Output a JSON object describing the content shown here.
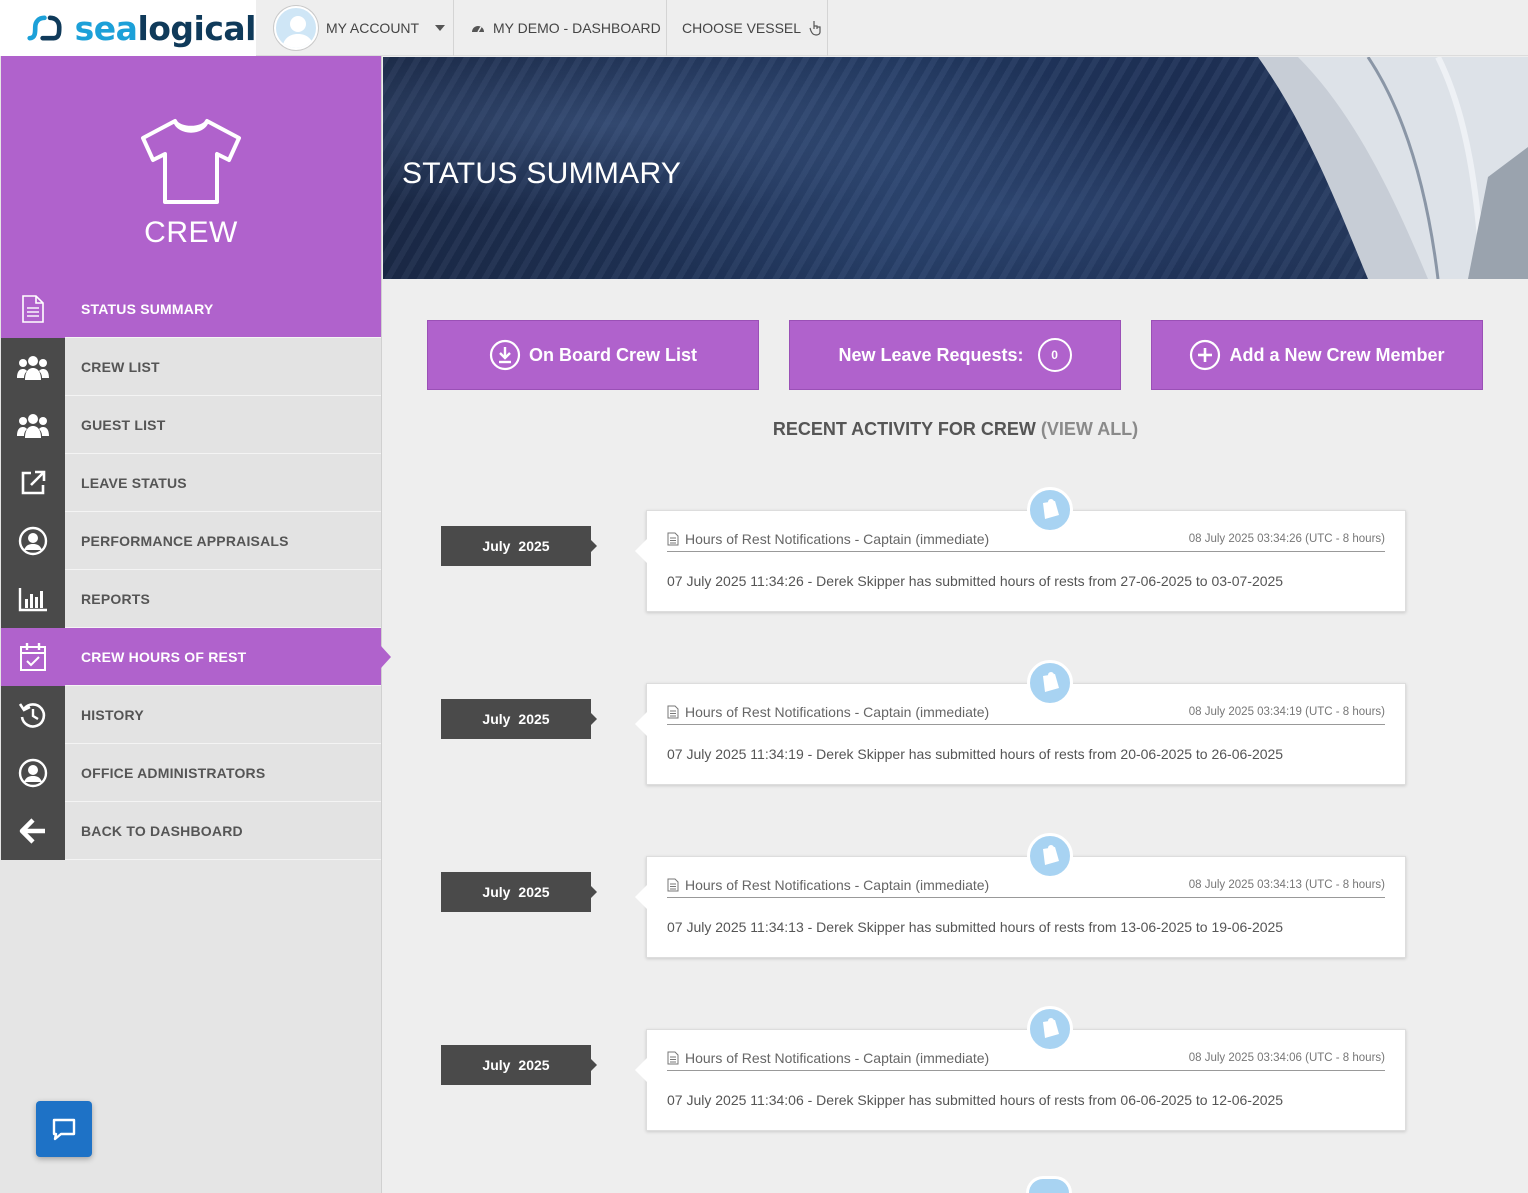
{
  "brand": {
    "part1": "sea",
    "part2": "logical"
  },
  "topnav": {
    "account": "MY ACCOUNT",
    "dashboard": "MY DEMO - DASHBOARD",
    "vessel": "CHOOSE VESSEL"
  },
  "section": {
    "title": "CREW"
  },
  "menu": [
    {
      "label": "STATUS SUMMARY",
      "icon": "document-icon"
    },
    {
      "label": "CREW LIST",
      "icon": "users-icon"
    },
    {
      "label": "GUEST LIST",
      "icon": "users-icon"
    },
    {
      "label": "LEAVE STATUS",
      "icon": "external-link-icon"
    },
    {
      "label": "PERFORMANCE APPRAISALS",
      "icon": "user-circle-icon"
    },
    {
      "label": "REPORTS",
      "icon": "bar-chart-icon"
    },
    {
      "label": "CREW HOURS OF REST",
      "icon": "calendar-check-icon"
    },
    {
      "label": "HISTORY",
      "icon": "history-icon"
    },
    {
      "label": "OFFICE ADMINISTRATORS",
      "icon": "user-circle-icon"
    },
    {
      "label": "BACK TO DASHBOARD",
      "icon": "arrow-left-icon"
    }
  ],
  "banner": {
    "title": "STATUS SUMMARY"
  },
  "actions": {
    "onboard": "On Board Crew List",
    "leave": "New Leave Requests:",
    "leave_count": "0",
    "add": "Add a New Crew Member"
  },
  "recent": {
    "title": "RECENT ACTIVITY FOR CREW",
    "view_all": "(VIEW ALL)"
  },
  "activity": [
    {
      "month": "July",
      "year": "2025",
      "title": "Hours of Rest Notifications - Captain (immediate)",
      "timestamp": "08 July 2025 03:34:26  (UTC - 8 hours)",
      "text": "07 July 2025 11:34:26 - Derek Skipper has submitted hours of rests from 27-06-2025 to 03-07-2025"
    },
    {
      "month": "July",
      "year": "2025",
      "title": "Hours of Rest Notifications - Captain (immediate)",
      "timestamp": "08 July 2025 03:34:19  (UTC - 8 hours)",
      "text": "07 July 2025 11:34:19 - Derek Skipper has submitted hours of rests from 20-06-2025 to 26-06-2025"
    },
    {
      "month": "July",
      "year": "2025",
      "title": "Hours of Rest Notifications - Captain (immediate)",
      "timestamp": "08 July 2025 03:34:13  (UTC - 8 hours)",
      "text": "07 July 2025 11:34:13 - Derek Skipper has submitted hours of rests from 13-06-2025 to 19-06-2025"
    },
    {
      "month": "July",
      "year": "2025",
      "title": "Hours of Rest Notifications - Captain (immediate)",
      "timestamp": "08 July 2025 03:34:06  (UTC - 8 hours)",
      "text": "07 July 2025 11:34:06 - Derek Skipper has submitted hours of rests from 06-06-2025 to 12-06-2025"
    }
  ],
  "colors": {
    "accent": "#b062cc",
    "dark": "#4a4a4a",
    "chat": "#1e72c6"
  }
}
